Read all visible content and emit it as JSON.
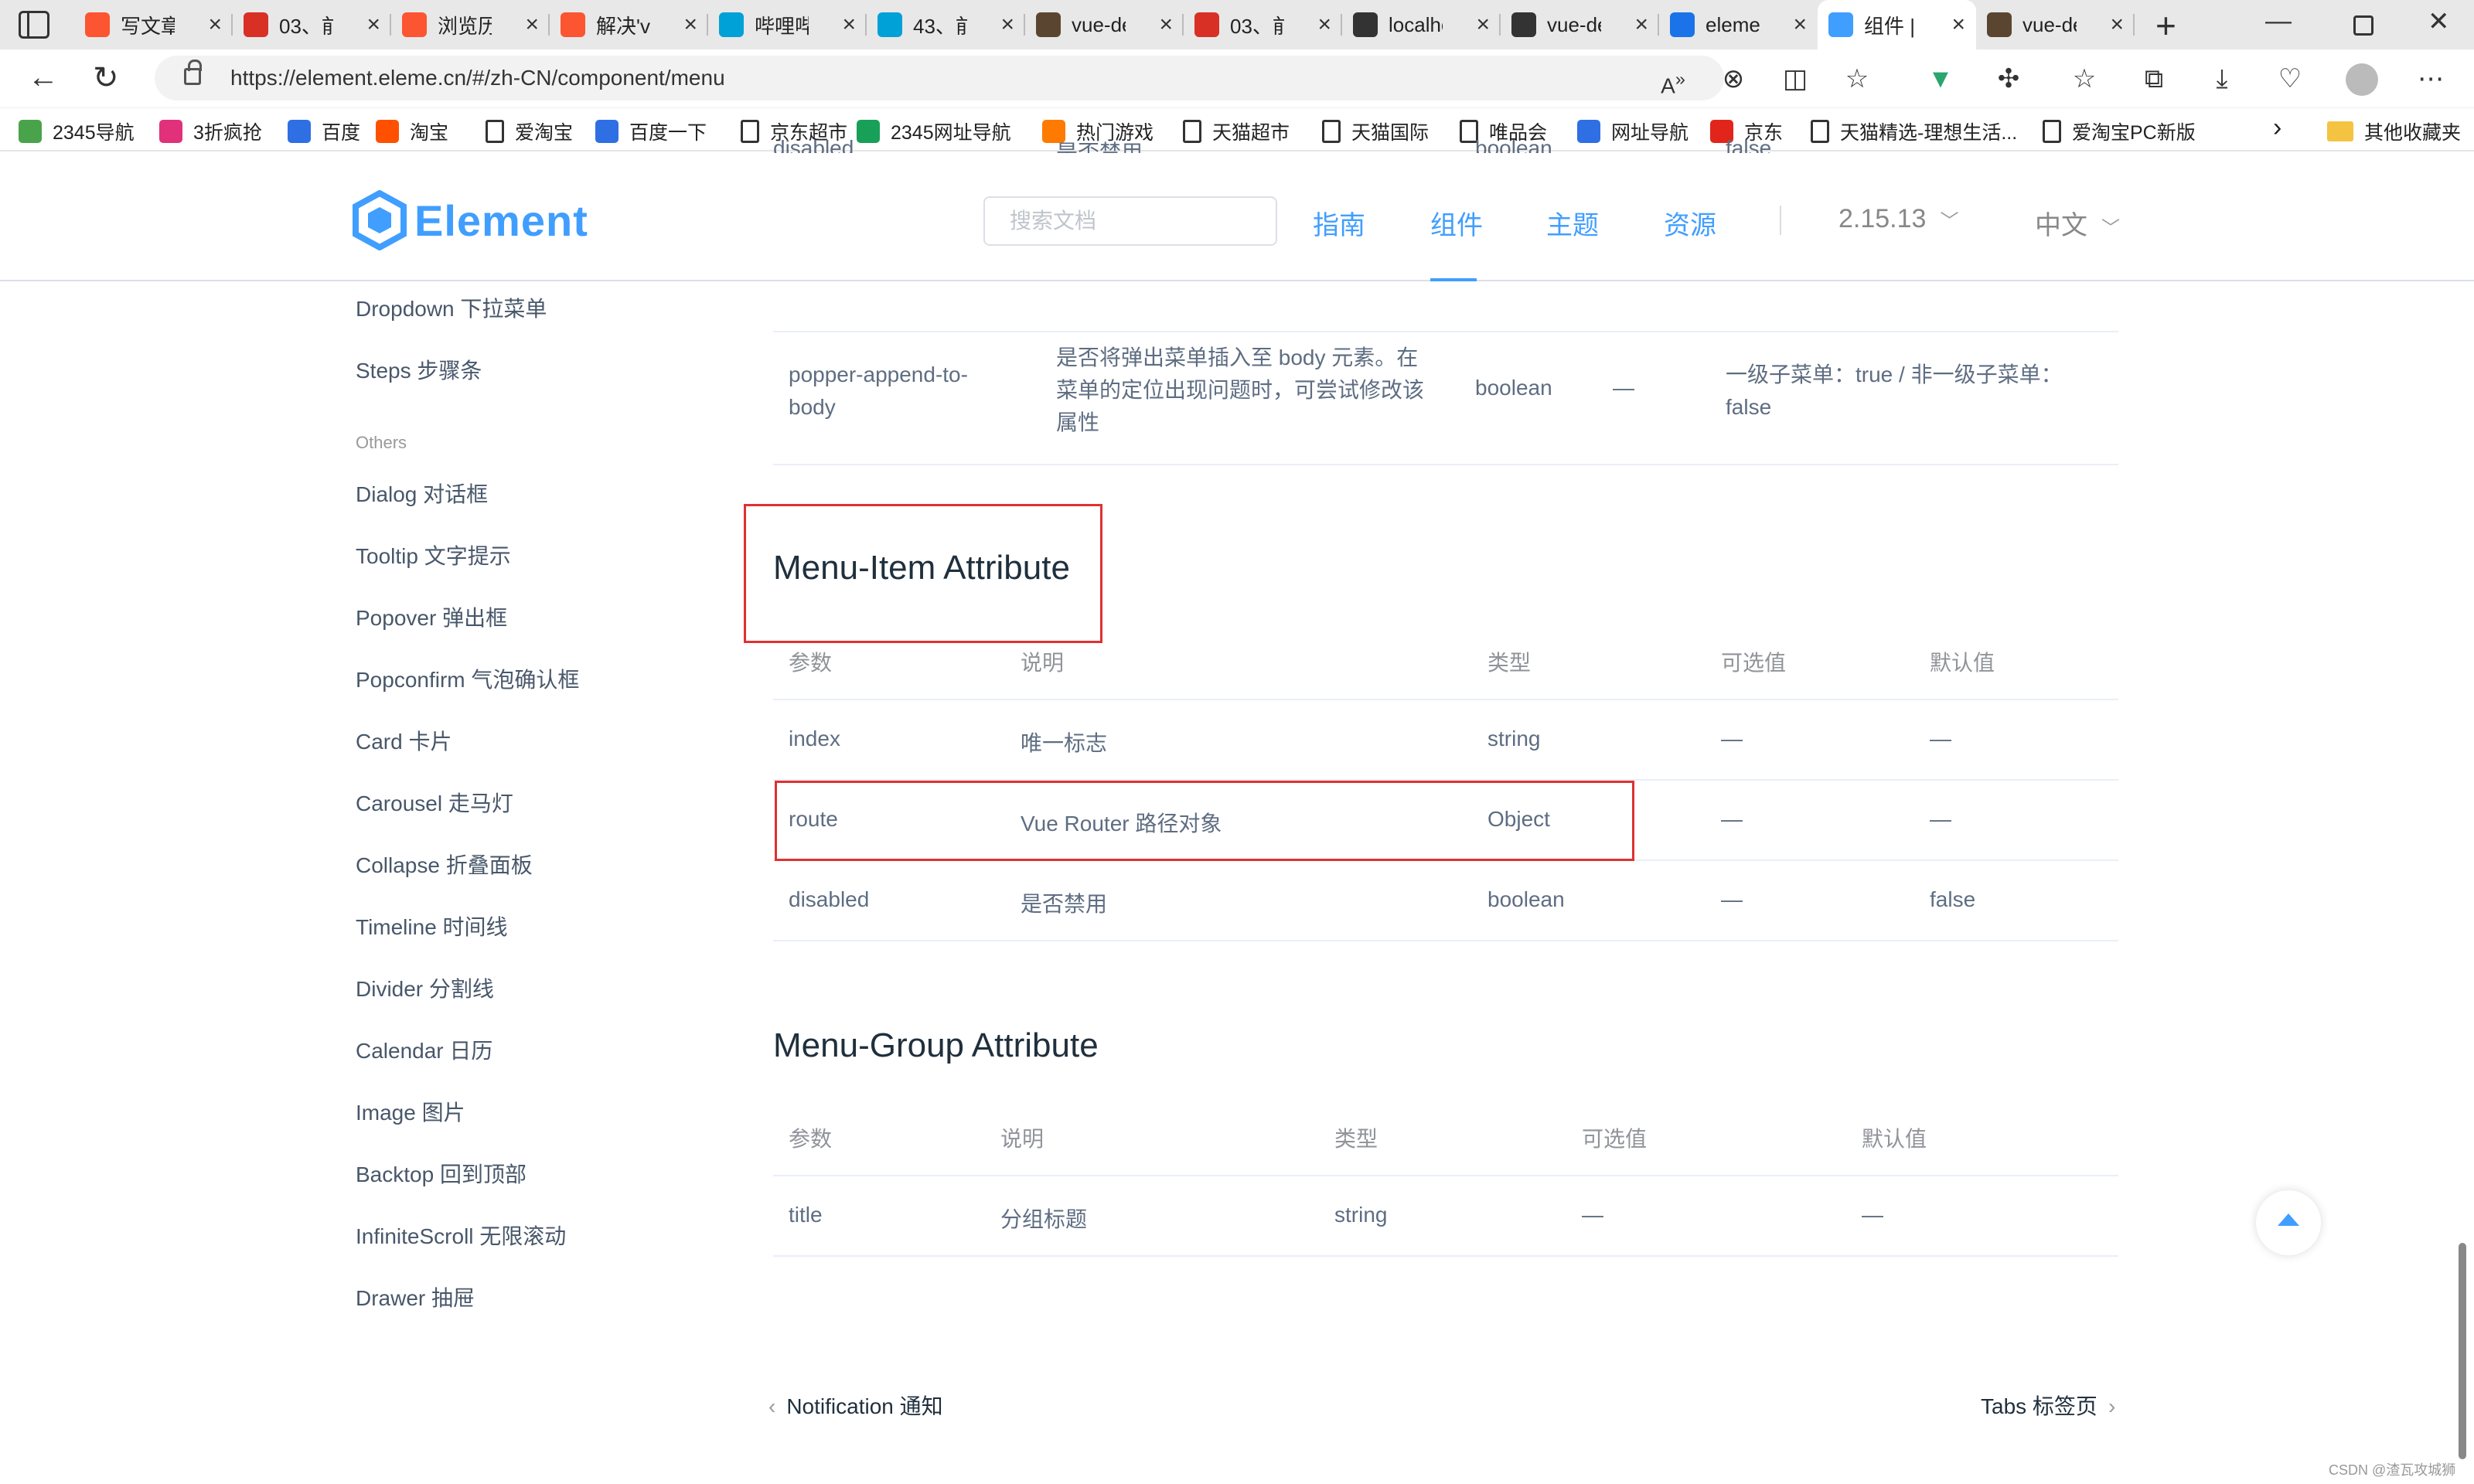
{
  "browser": {
    "tabs": [
      {
        "title": "写文章",
        "icon": "csdn-icon",
        "color": "#fc5531"
      },
      {
        "title": "03、前",
        "icon": "pdf-icon",
        "color": "#d93025"
      },
      {
        "title": "浏览历",
        "icon": "csdn-icon",
        "color": "#fc5531"
      },
      {
        "title": "解决'vu",
        "icon": "csdn-icon",
        "color": "#fc5531"
      },
      {
        "title": "哔哩哔",
        "icon": "bilibili-icon",
        "color": "#00a1d6"
      },
      {
        "title": "43、前",
        "icon": "bilibili-icon",
        "color": "#00a1d6"
      },
      {
        "title": "vue-de",
        "icon": "avatar-icon",
        "color": "#5a4630"
      },
      {
        "title": "03、前",
        "icon": "pdf-icon",
        "color": "#d93025"
      },
      {
        "title": "localho",
        "icon": "page-icon",
        "color": "#333333"
      },
      {
        "title": "vue-de",
        "icon": "page-icon",
        "color": "#333333"
      },
      {
        "title": "elemen",
        "icon": "search-icon",
        "color": "#1a73e8"
      },
      {
        "title": "组件 | E",
        "icon": "element-icon",
        "color": "#409eff"
      },
      {
        "title": "vue-de",
        "icon": "avatar-icon",
        "color": "#5a4630"
      }
    ],
    "active_tab": 11,
    "url": "https://element.eleme.cn/#/zh-CN/component/menu",
    "bookmarks": [
      {
        "label": "2345导航"
      },
      {
        "label": "3折疯抢"
      },
      {
        "label": "百度"
      },
      {
        "label": "淘宝"
      },
      {
        "label": "爱淘宝"
      },
      {
        "label": "百度一下"
      },
      {
        "label": "京东超市"
      },
      {
        "label": "2345网址导航"
      },
      {
        "label": "热门游戏"
      },
      {
        "label": "天猫超市"
      },
      {
        "label": "天猫国际"
      },
      {
        "label": "唯品会"
      },
      {
        "label": "网址导航"
      },
      {
        "label": "京东"
      },
      {
        "label": "天猫精选-理想生活..."
      },
      {
        "label": "爱淘宝PC新版"
      }
    ],
    "other_bookmarks": "其他收藏夹"
  },
  "site": {
    "logo_text": "Element",
    "search_placeholder": "搜索文档",
    "nav": [
      "指南",
      "组件",
      "主题",
      "资源"
    ],
    "active_nav": "组件",
    "version": "2.15.13",
    "language": "中文"
  },
  "sidebar": {
    "items_top": [
      "Dropdown 下拉菜单",
      "Steps 步骤条"
    ],
    "group_label": "Others",
    "items": [
      "Dialog 对话框",
      "Tooltip 文字提示",
      "Popover 弹出框",
      "Popconfirm 气泡确认框",
      "Card 卡片",
      "Carousel 走马灯",
      "Collapse 折叠面板",
      "Timeline 时间线",
      "Divider 分割线",
      "Calendar 日历",
      "Image 图片",
      "Backtop 回到顶部",
      "InfiniteScroll 无限滚动",
      "Drawer 抽屉"
    ]
  },
  "submenu_table": {
    "partial_row": [
      "disabled",
      "是否禁用",
      "boolean",
      "—",
      "false"
    ],
    "row": {
      "param": "popper-append-to-body",
      "param_lines": [
        "popper-append-to-",
        "body"
      ],
      "desc_lines": [
        "是否将弹出菜单插入至 body 元素。在",
        "菜单的定位出现问题时，可尝试修改该",
        "属性"
      ],
      "type": "boolean",
      "options": "—",
      "default_lines": [
        "一级子菜单：true / 非一级子菜单：",
        "false"
      ]
    }
  },
  "menu_item_attr": {
    "title": "Menu-Item Attribute",
    "headers": [
      "参数",
      "说明",
      "类型",
      "可选值",
      "默认值"
    ],
    "rows": [
      [
        "index",
        "唯一标志",
        "string",
        "—",
        "—"
      ],
      [
        "route",
        "Vue Router 路径对象",
        "Object",
        "—",
        "—"
      ],
      [
        "disabled",
        "是否禁用",
        "boolean",
        "—",
        "false"
      ]
    ]
  },
  "menu_group_attr": {
    "title": "Menu-Group Attribute",
    "headers": [
      "参数",
      "说明",
      "类型",
      "可选值",
      "默认值"
    ],
    "rows": [
      [
        "title",
        "分组标题",
        "string",
        "—",
        "—"
      ]
    ]
  },
  "footer_nav": {
    "prev": "Notification 通知",
    "next": "Tabs 标签页"
  },
  "watermark": "CSDN @渣瓦攻城狮"
}
